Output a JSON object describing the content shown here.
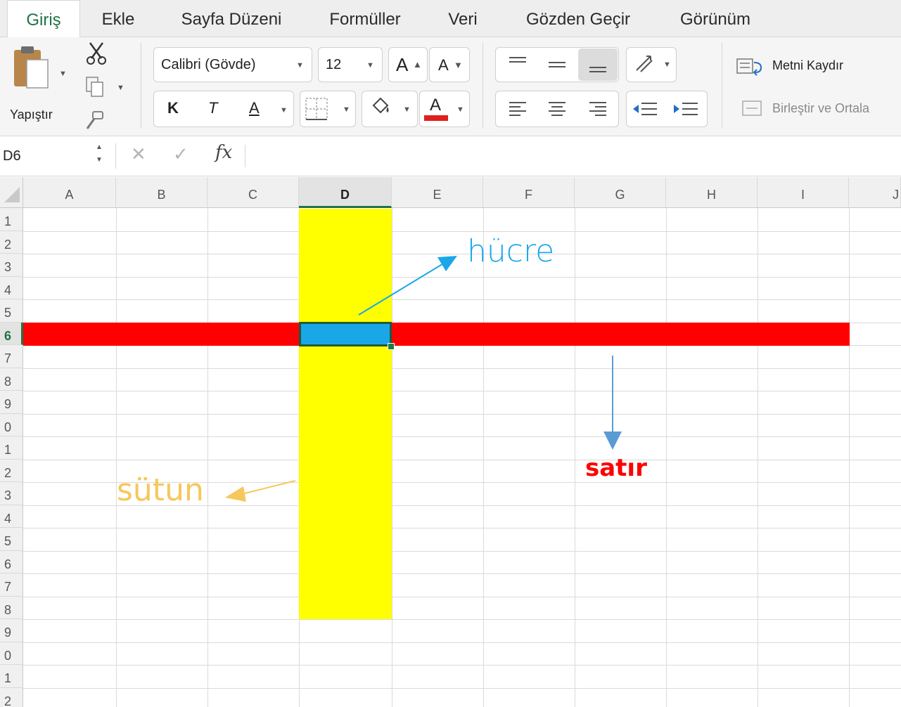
{
  "tabs": [
    "Giriş",
    "Ekle",
    "Sayfa Düzeni",
    "Formüller",
    "Veri",
    "Gözden Geçir",
    "Görünüm"
  ],
  "active_tab": "Giriş",
  "ribbon": {
    "paste_label": "Yapıştır",
    "font_name": "Calibri (Gövde)",
    "font_size": "12",
    "grow_font": "A",
    "shrink_font": "A",
    "bold": "K",
    "italic": "T",
    "underline": "A",
    "font_color_letter": "A",
    "wrap_text": "Metni Kaydır",
    "merge_center": "Birleştir ve Ortala"
  },
  "formula_bar": {
    "name_box": "D6",
    "fx": "fx",
    "cancel_glyph": "✕",
    "enter_glyph": "✓",
    "formula": ""
  },
  "columns": [
    "A",
    "B",
    "C",
    "D",
    "E",
    "F",
    "G",
    "H",
    "I",
    "J"
  ],
  "rows": [
    "1",
    "2",
    "3",
    "4",
    "5",
    "6",
    "7",
    "8",
    "9",
    "0",
    "1",
    "2",
    "3",
    "4",
    "5",
    "6",
    "7",
    "8",
    "9",
    "0",
    "1",
    "2"
  ],
  "selected_cell": "D6",
  "annotations": {
    "cell": "hücre",
    "row": "satır",
    "column": "sütun"
  },
  "colors": {
    "accent": "#217346",
    "row_highlight": "#ff0000",
    "column_highlight": "#ffff00",
    "cell_highlight": "#1aa7e8",
    "cell_label": "#1aa7e8",
    "row_label": "#ff0000",
    "column_label": "#f6c75a",
    "row_arrow": "#5b9bd5"
  }
}
